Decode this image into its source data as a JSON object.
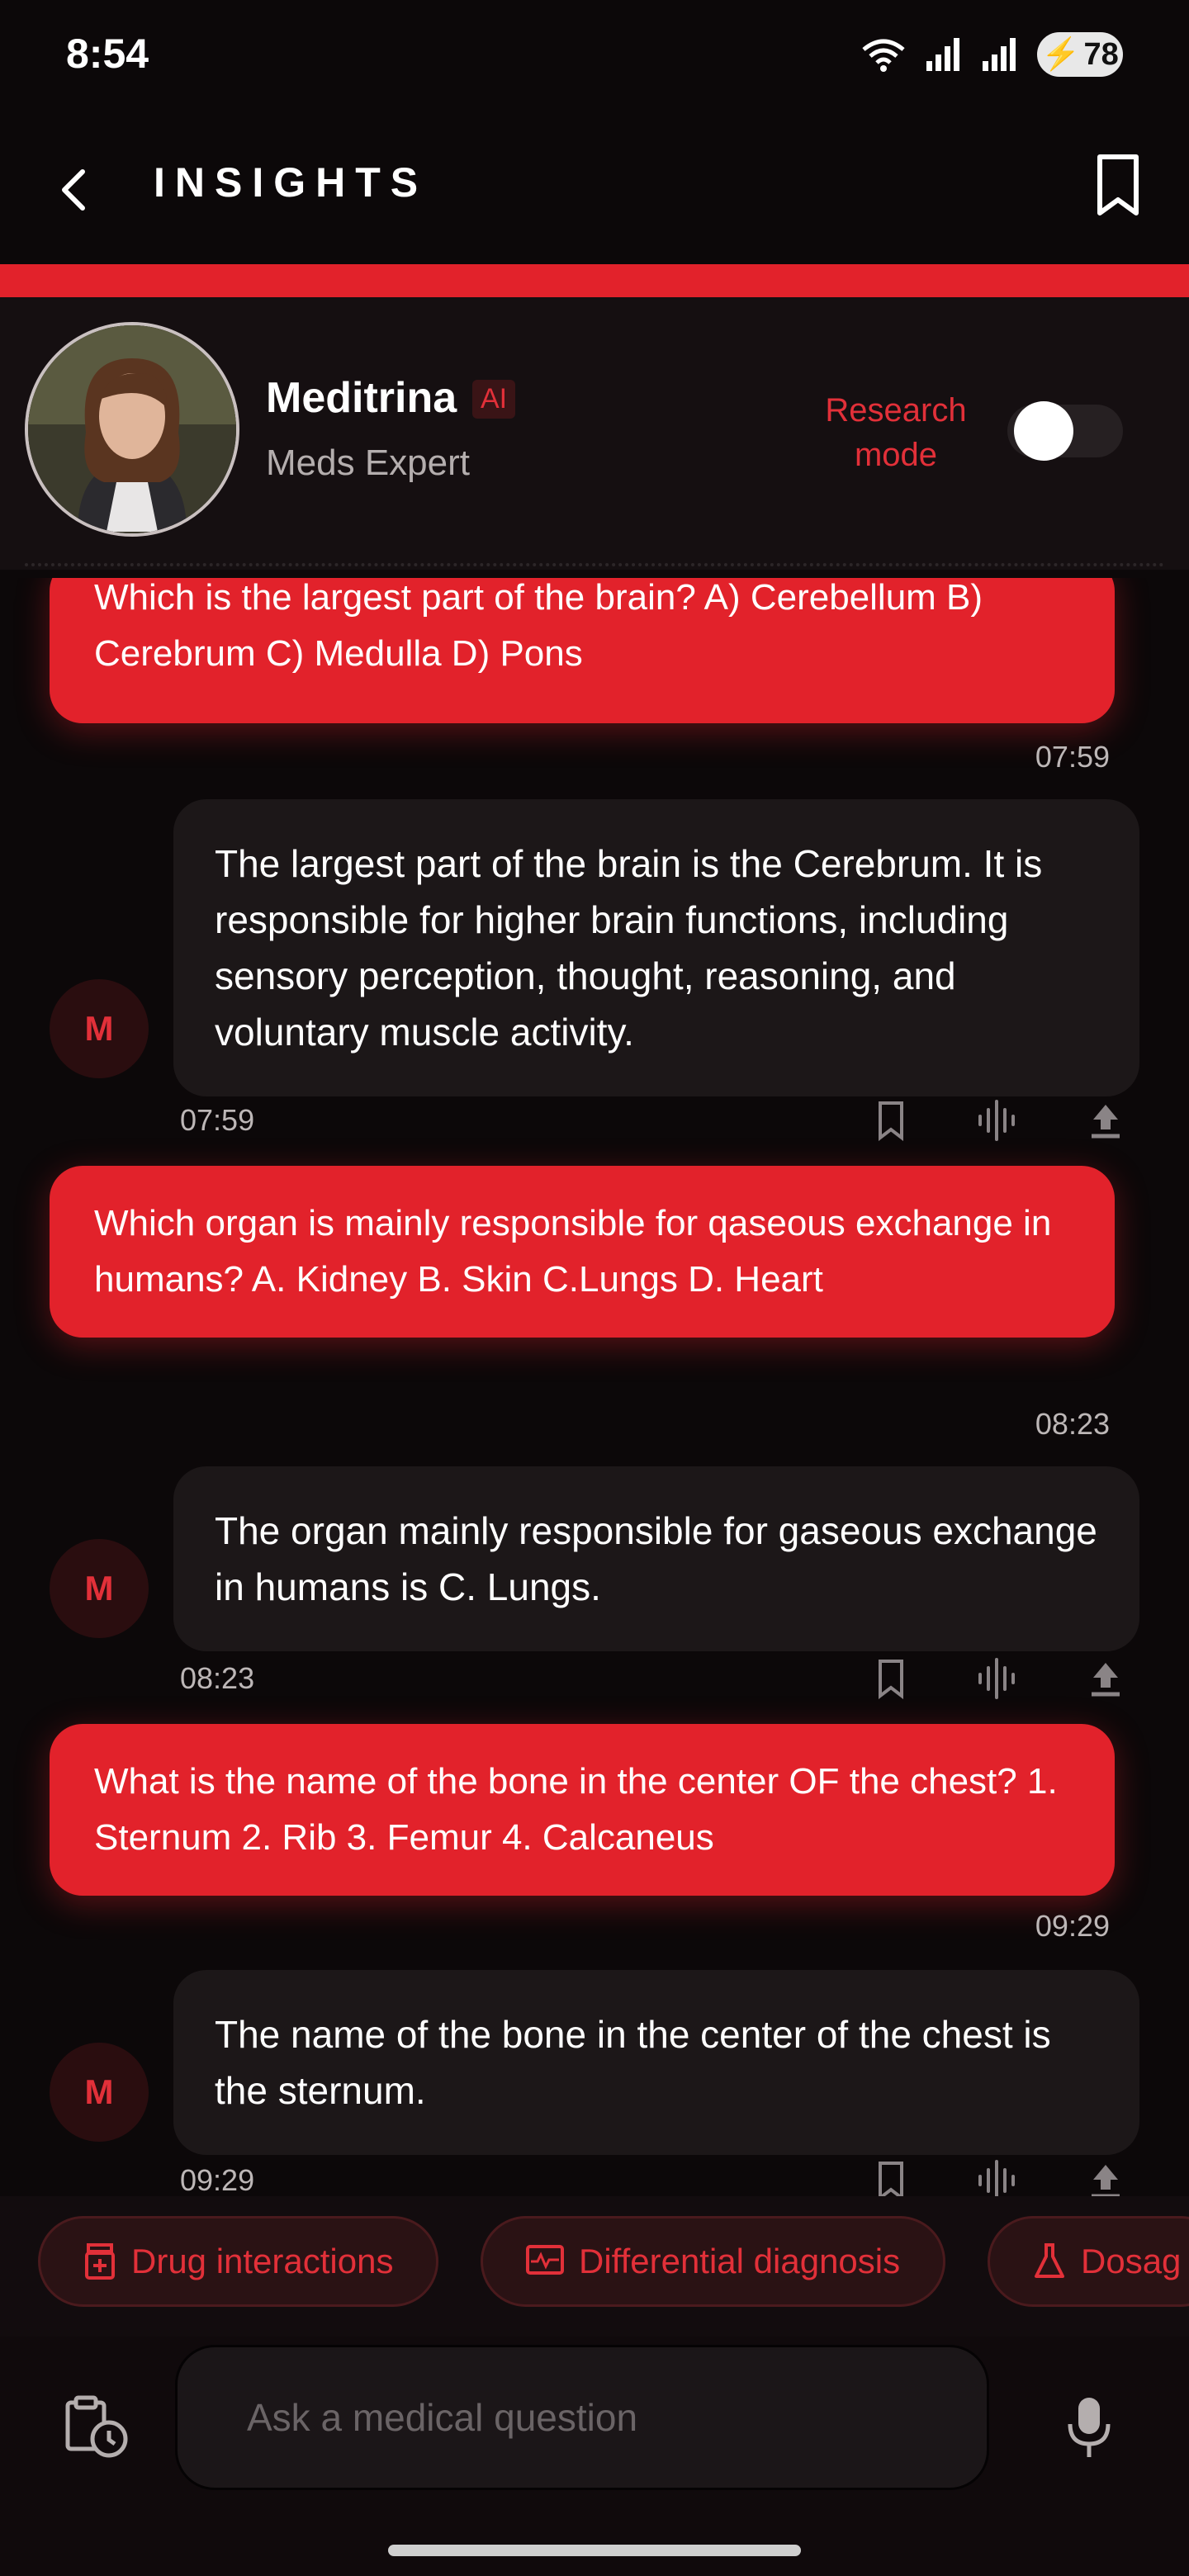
{
  "status": {
    "time": "8:54",
    "battery": "78"
  },
  "header": {
    "title": "INSIGHTS"
  },
  "profile": {
    "name": "Meditrina",
    "badge": "AI",
    "role": "Meds Expert",
    "research_mode": "Research mode",
    "research_mode_on": false
  },
  "avatar_initial": "M",
  "messages": [
    {
      "role": "user",
      "text": "Which is the largest part of the brain? A) Cerebellum B) Cerebrum C) Medulla D) Pons",
      "time": "07:59"
    },
    {
      "role": "bot",
      "text": "The largest part of the brain is the Cerebrum. It is responsible for higher brain functions, including sensory perception, thought, reasoning, and voluntary muscle activity.",
      "time": "07:59"
    },
    {
      "role": "user",
      "text": "Which organ is mainly responsible for qaseous exchange in humans? A. Kidney B. Skin C.Lungs D. Heart",
      "time": "08:23"
    },
    {
      "role": "bot",
      "text": "The organ mainly responsible for gaseous exchange in humans is C. Lungs.",
      "time": "08:23"
    },
    {
      "role": "user",
      "text": "What is the name of the bone in the center OF the chest? 1. Sternum 2. Rib 3. Femur 4. Calcaneus",
      "time": "09:29"
    },
    {
      "role": "bot",
      "text": "The name of the bone in the center of the chest is the sternum.",
      "time": "09:29"
    }
  ],
  "chips": [
    "Drug interactions",
    "Differential diagnosis",
    "Dosag"
  ],
  "input": {
    "placeholder": "Ask a medical question",
    "value": ""
  },
  "colors": {
    "accent": "#e2222b",
    "background": "#0c0809",
    "bot_bubble": "#1c1718"
  }
}
